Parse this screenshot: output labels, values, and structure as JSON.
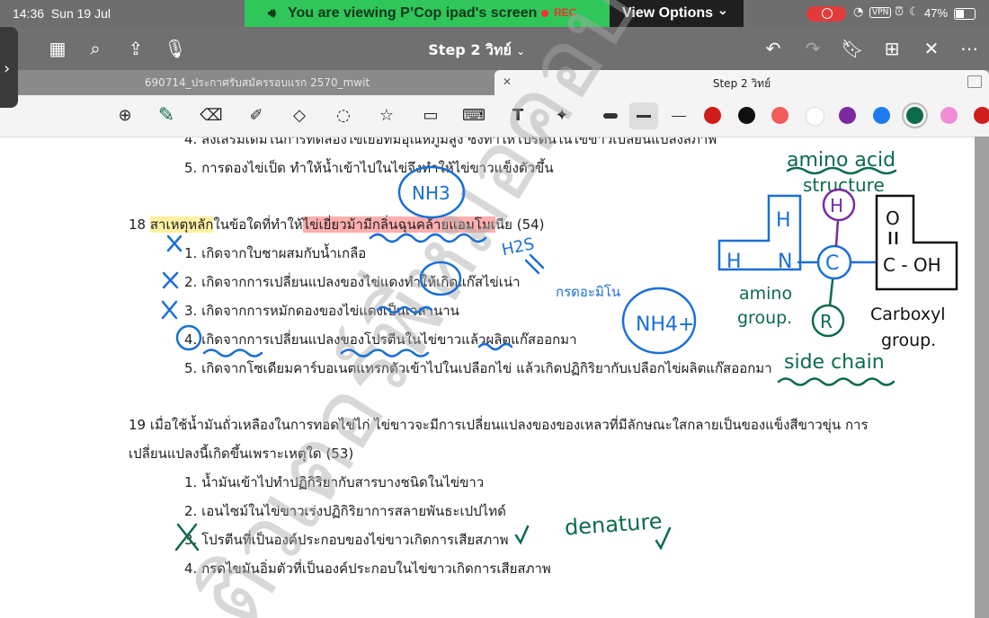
{
  "status_bar": {
    "time": "14:36",
    "date": "Sun 19 Jul",
    "share_banner": "You are viewing  P’Cop ipad's screen",
    "rec_label": "REC",
    "view_options": "View Options",
    "battery": "47%",
    "vpn": "VPN"
  },
  "nav": {
    "title": "Step 2 วิทย์"
  },
  "tabs": {
    "tab1": "690714_ประกาศรับสมัครรอบแรก 2570_mwit",
    "tab2": "Step 2 วิทย์"
  },
  "toolbar": {
    "colors": [
      "#d11c1c",
      "#101010",
      "#f25c5c",
      "#ffffff",
      "#7b2aa0",
      "#1e7cf0",
      "#0c6b4b",
      "#f28cd6",
      "#d11c1c"
    ],
    "selected_color": "#0c6b4b"
  },
  "document": {
    "q17": {
      "opt4": "4. ส่งเสริมเดิมในการทดลองไข่เยื่อที่มีอุณหภูมิสูง ซึ่งทำให้โปรตีนในไข่ขาวเปลี่ยนแปลงสภาพ",
      "opt5": "5. การดองไข่เป็ด ทำให้น้ำเข้าไปในไข่จึงทำให้ไข่ขาวแข็งตัวขึ้น"
    },
    "q18": {
      "num": "18",
      "stem_a": "สาเหตุหลัก",
      "stem_b": "ในข้อใดที่ทำให้",
      "stem_c": "ไข่เยี่ยวม้ามีกลิ่นฉุนคล้ายแอมโมเ",
      "stem_d": "นีย (54)",
      "opt1": "1. เกิดจากใบชาผสมกับน้ำเกลือ",
      "opt2": "2. เกิดจากการเปลี่ยนแปลงของไข่แดงทำให้เกิดแก๊สไข่เน่า",
      "opt3": "3. เกิดจากการหมักดองของไข่แดงเป็นเวลานาน",
      "opt4": "4. เกิดจากการเปลี่ยนแปลงของโปรตีนในไข่ขาวแล้วผลิตแก๊สออกมา",
      "opt5": "5. เกิดจากโซเดียมคาร์บอเนตแทรกตัวเข้าไปในเปลือกไข่ แล้วเกิดปฏิกิริยากับเปลือกไข่ผลิตแก๊สออกมา"
    },
    "q19": {
      "stem1": "19 เมื่อใช้น้ำมันถั่วเหลืองในการทอดไข่ไก่ ไข่ขาวจะมีการเปลี่ยนแปลงของของเหลวที่มีลักษณะใสกลายเป็นของแข็งสีขาวขุ่น การ",
      "stem2": "เปลี่ยนแปลงนี้เกิดขึ้นเพราะเหตุใด (53)",
      "opt1": "1. น้ำมันเข้าไปทำปฏิกิริยากับสารบางชนิดในไข่ขาว",
      "opt2": "2. เอนไซม์ในไข่ขาวเร่งปฏิกิริยาการสลายพันธะเปปไทด์",
      "opt3": "3. โปรตีนที่เป็นองค์ประกอบของไข่ขาวเกิดการเสียสภาพ",
      "opt4": "4. กรดไขมันอิ่มตัวที่เป็นองค์ประกอบในไข่ขาวเกิดการเสียสภาพ"
    },
    "watermark": "ติวเตอร์พี่หมอคอป"
  },
  "annotations": {
    "nh3": "NH3",
    "h2s": "H2S",
    "amino_acid_prefix": "กรดอะมิโน",
    "nh4": "NH4+",
    "amino_acid": "amino acid",
    "structure": "structure",
    "amino_group_1": "amino",
    "amino_group_2": "group.",
    "h_atom": "H",
    "n_atom": "N",
    "c_atom": "C",
    "r_group": "R",
    "carboxyl_o": "O",
    "carboxyl_coh": "C - OH",
    "carboxyl_1": "Carboxyl",
    "carboxyl_2": "group.",
    "side_chain": "side chain",
    "denature": "denature",
    "ink_blue": "#1a6fd6",
    "ink_green": "#0c6b4b",
    "ink_purple": "#7b2aa0"
  }
}
